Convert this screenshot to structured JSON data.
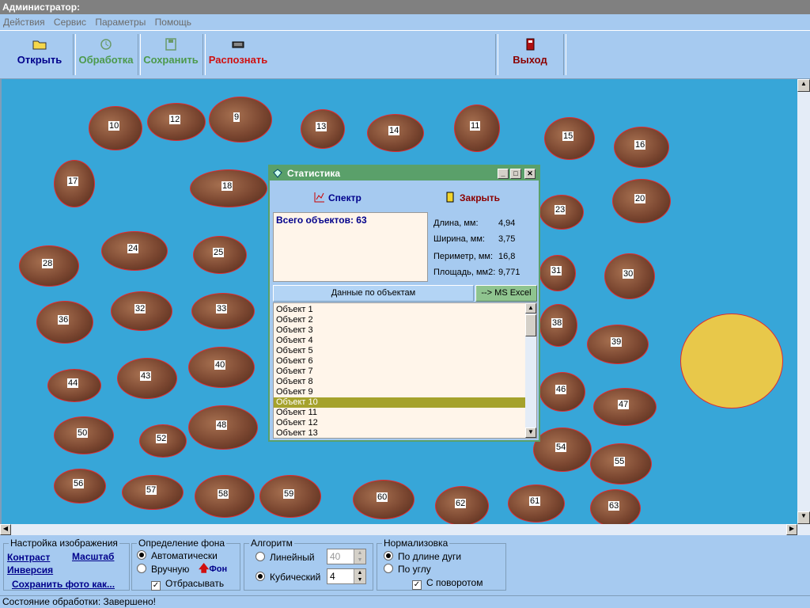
{
  "window": {
    "title": "Администратор:"
  },
  "menu": [
    "Действия",
    "Сервис",
    "Параметры",
    "Помощь"
  ],
  "toolbar": {
    "open": "Открыть",
    "process": "Обработка",
    "save": "Сохранить",
    "recognize": "Распознать",
    "exit": "Выход"
  },
  "grains": [
    "9",
    "10",
    "11",
    "12",
    "13",
    "14",
    "15",
    "16",
    "17",
    "18",
    "20",
    "23",
    "24",
    "25",
    "28",
    "30",
    "31",
    "32",
    "33",
    "36",
    "38",
    "39",
    "40",
    "43",
    "44",
    "46",
    "47",
    "48",
    "50",
    "52",
    "54",
    "55",
    "56",
    "57",
    "58",
    "59",
    "60",
    "61",
    "62",
    "63"
  ],
  "stats_dialog": {
    "title": "Статистика",
    "spectrum_button": "Спектр",
    "close_button": "Закрыть",
    "total_objects": "Всего объектов: 63",
    "length_label": "Длина, мм:",
    "length_value": "4,94",
    "width_label": "Ширина, мм:",
    "width_value": "3,75",
    "perimeter_label": "Периметр, мм:",
    "perimeter_value": "16,8",
    "area_label": "Площадь, мм2:",
    "area_value": "9,771",
    "object_data_button": "Данные по объектам",
    "excel_button": "--> MS Excel",
    "objects": [
      "Объект 1",
      "Объект 2",
      "Объект 3",
      "Объект 4",
      "Объект 5",
      "Объект 6",
      "Объект 7",
      "Объект 8",
      "Объект 9",
      "Объект 10",
      "Объект 11",
      "Объект 12",
      "Объект 13"
    ],
    "selected_object": "Объект 10"
  },
  "panel_image": {
    "title": "Настройка изображения",
    "contrast": "Контраст",
    "scale": "Масштаб",
    "inversion": "Инверсия",
    "save_photo": "Сохранить фото как..."
  },
  "panel_bg": {
    "title": "Определение фона",
    "auto": "Автоматически",
    "manual": "Вручную",
    "discard": "Отбрасывать",
    "bg_button": "Фон"
  },
  "panel_algo": {
    "title": "Алгоритм",
    "linear": "Линейный",
    "linear_value": "40",
    "cubic": "Кубический",
    "cubic_value": "4"
  },
  "panel_norm": {
    "title": "Нормализовка",
    "by_length": "По длине дуги",
    "by_angle": "По углу",
    "rotation": "С поворотом"
  },
  "status": "Состояние обработки: Завершено!",
  "colors": {
    "canvas": "#37a6d8",
    "accent_red": "#d01010",
    "dialog_title": "#5aa06a"
  }
}
